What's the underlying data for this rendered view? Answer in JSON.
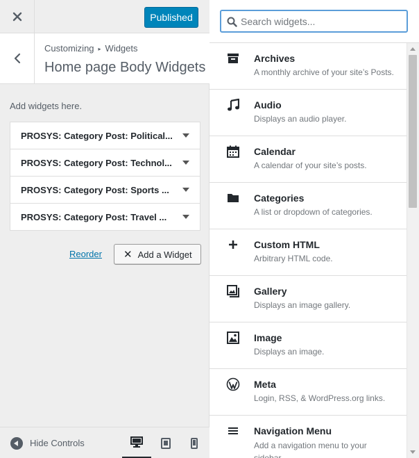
{
  "topbar": {
    "published_label": "Published"
  },
  "section": {
    "breadcrumb": [
      "Customizing",
      "Widgets"
    ],
    "title": "Home page Body Widgets"
  },
  "hint": "Add widgets here.",
  "widgets": [
    {
      "title": "PROSYS: Category Post: Political..."
    },
    {
      "title": "PROSYS: Category Post: Technol..."
    },
    {
      "title": "PROSYS: Category Post: Sports ..."
    },
    {
      "title": "PROSYS: Category Post: Travel ..."
    }
  ],
  "actions": {
    "reorder_label": "Reorder",
    "add_widget_label": "Add a Widget"
  },
  "footer": {
    "hide_controls_label": "Hide Controls",
    "active_device": "desktop"
  },
  "search": {
    "placeholder": "Search widgets..."
  },
  "available_widgets": [
    {
      "icon": "archive-icon",
      "title": "Archives",
      "desc": "A monthly archive of your site’s Posts."
    },
    {
      "icon": "audio-icon",
      "title": "Audio",
      "desc": "Displays an audio player."
    },
    {
      "icon": "calendar-icon",
      "title": "Calendar",
      "desc": "A calendar of your site’s posts."
    },
    {
      "icon": "folder-icon",
      "title": "Categories",
      "desc": "A list or dropdown of categories."
    },
    {
      "icon": "plus-icon",
      "title": "Custom HTML",
      "desc": "Arbitrary HTML code."
    },
    {
      "icon": "gallery-icon",
      "title": "Gallery",
      "desc": "Displays an image gallery."
    },
    {
      "icon": "image-icon",
      "title": "Image",
      "desc": "Displays an image."
    },
    {
      "icon": "wordpress-icon",
      "title": "Meta",
      "desc": "Login, RSS, & WordPress.org links."
    },
    {
      "icon": "menu-icon",
      "title": "Navigation Menu",
      "desc": "Add a navigation menu to your sidebar."
    }
  ],
  "colors": {
    "primary": "#0085ba",
    "link": "#0073aa",
    "focus": "#5b9dd9",
    "panel_bg": "#eeeeee"
  }
}
